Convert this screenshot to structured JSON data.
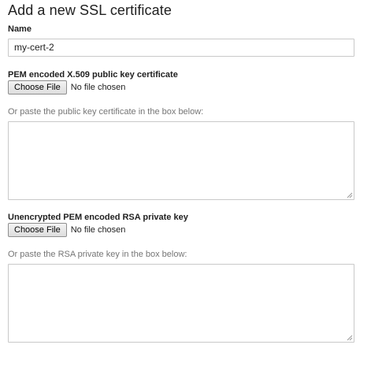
{
  "form": {
    "title": "Add a new SSL certificate",
    "name_label": "Name",
    "name_value": "my-cert-2",
    "cert_label": "PEM encoded X.509 public key certificate",
    "cert_file_button": "Choose File",
    "cert_file_status": "No file chosen",
    "cert_paste_hint": "Or paste the public key certificate in the box below:",
    "cert_textarea_value": "",
    "key_label": "Unencrypted PEM encoded RSA private key",
    "key_file_button": "Choose File",
    "key_file_status": "No file chosen",
    "key_paste_hint": "Or paste the RSA private key in the box below:",
    "key_textarea_value": ""
  },
  "icons": {
    "resize_grip": "resize-grip-icon"
  },
  "colors": {
    "text": "#212121",
    "hint_text": "#757575",
    "border": "#c9c9c9"
  }
}
